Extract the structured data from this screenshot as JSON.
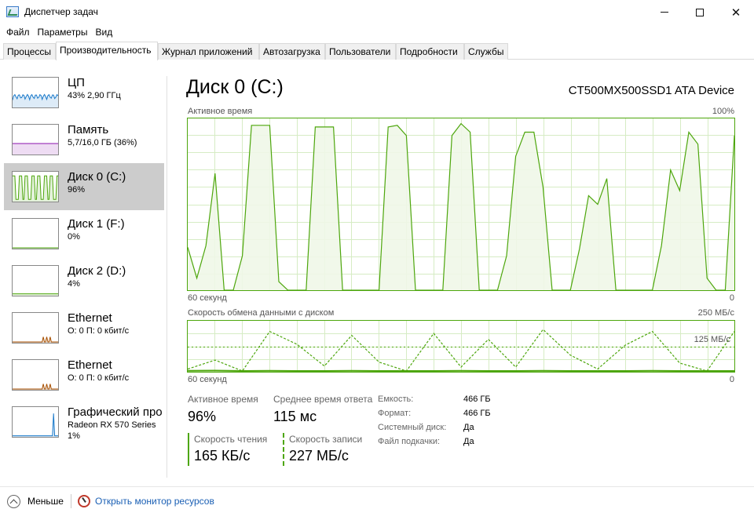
{
  "window": {
    "title": "Диспетчер задач",
    "app_icon": "task-manager-icon",
    "controls": {
      "minimize": "—",
      "close": "✕"
    }
  },
  "menu": [
    "Файл",
    "Параметры",
    "Вид"
  ],
  "tabs": [
    "Процессы",
    "Производительность",
    "Журнал приложений",
    "Автозагрузка",
    "Пользователи",
    "Подробности",
    "Службы"
  ],
  "active_tab": "Производительность",
  "sidebar": {
    "items": [
      {
        "name": "ЦП",
        "sub": "43% 2,90 ГГц",
        "color": "#1979ca",
        "level_pct": 43
      },
      {
        "name": "Память",
        "sub": "5,7/16,0 ГБ (36%)",
        "color": "#8b12ae",
        "level_pct": 36
      },
      {
        "name": "Диск 0 (C:)",
        "sub": "96%",
        "color": "#4da60c",
        "level_pct": 96,
        "selected": true
      },
      {
        "name": "Диск 1 (F:)",
        "sub": "0%",
        "color": "#4da60c",
        "level_pct": 0
      },
      {
        "name": "Диск 2 (D:)",
        "sub": "4%",
        "color": "#4da60c",
        "level_pct": 4
      },
      {
        "name": "Ethernet",
        "sub": "О: 0 П: 0 кбит/с",
        "color": "#a74f01"
      },
      {
        "name": "Ethernet",
        "sub": "О: 0 П: 0 кбит/с",
        "color": "#a74f01"
      },
      {
        "name": "Графический про",
        "sub": "Radeon RX 570 Series",
        "sub2": "1%",
        "color": "#1979ca",
        "level_pct": 1
      }
    ]
  },
  "main": {
    "title": "Диск 0 (C:)",
    "device": "CT500MX500SSD1 ATA Device",
    "chart1": {
      "label": "Активное время",
      "max_label": "100%",
      "x_label": "60 секунд",
      "min_label": "0"
    },
    "chart2": {
      "label": "Скорость обмена данными с диском",
      "max_label": "250 МБ/с",
      "mid_label": "125 МБ/с",
      "x_label": "60 секунд",
      "min_label": "0"
    },
    "stats": {
      "active_time_label": "Активное время",
      "active_time_value": "96%",
      "response_label": "Среднее время ответа",
      "response_value": "115 мс",
      "read_label": "Скорость чтения",
      "read_value": "165 КБ/с",
      "write_label": "Скорость записи",
      "write_value": "227 МБ/с"
    },
    "properties": [
      {
        "label": "Емкость:",
        "value": "466 ГБ"
      },
      {
        "label": "Формат:",
        "value": "466 ГБ"
      },
      {
        "label": "Системный диск:",
        "value": "Да"
      },
      {
        "label": "Файл подкачки:",
        "value": "Да"
      }
    ]
  },
  "footer": {
    "less_label": "Меньше",
    "less_icon": "chevron-up-circle-icon",
    "resmon_label": "Открыть монитор ресурсов",
    "resmon_icon": "resource-monitor-icon"
  },
  "colors": {
    "disk_line": "#4da60c",
    "disk_fill": "#eff7e8",
    "grid": "#d6ecc4",
    "selected_bg": "#cccccc"
  },
  "chart_data": [
    {
      "type": "area",
      "title": "Активное время",
      "xlabel": "60 секунд",
      "ylabel": "",
      "ylim": [
        0,
        100
      ],
      "x": [
        60,
        59,
        58,
        57,
        56,
        55,
        54,
        53,
        52,
        51,
        50,
        49,
        48,
        47,
        46,
        45,
        44,
        43,
        42,
        41,
        40,
        39,
        38,
        37,
        36,
        35,
        34,
        33,
        32,
        31,
        30,
        29,
        28,
        27,
        26,
        25,
        24,
        23,
        22,
        21,
        20,
        19,
        18,
        17,
        16,
        15,
        14,
        13,
        12,
        11,
        10,
        9,
        8,
        7,
        6,
        5,
        4,
        3,
        2,
        1,
        0
      ],
      "series": [
        {
          "values": [
            25,
            7,
            26,
            68,
            0,
            0,
            20,
            96,
            96,
            96,
            5,
            0,
            0,
            0,
            95,
            95,
            95,
            0,
            0,
            0,
            0,
            0,
            95,
            96,
            90,
            0,
            0,
            0,
            0,
            90,
            97,
            92,
            0,
            0,
            0,
            20,
            78,
            92,
            92,
            60,
            0,
            0,
            0,
            24,
            55,
            50,
            65,
            0,
            0,
            0,
            0,
            0,
            26,
            70,
            58,
            92,
            85,
            7,
            0,
            0,
            90
          ]
        }
      ]
    },
    {
      "type": "line",
      "title": "Скорость обмена данными с диском",
      "xlabel": "60 секунд",
      "ylabel": "МБ/с",
      "ylim": [
        0,
        250
      ],
      "x": [
        60,
        57,
        54,
        51,
        48,
        45,
        42,
        39,
        36,
        33,
        30,
        27,
        24,
        21,
        18,
        15,
        12,
        9,
        6,
        3,
        0
      ],
      "series": [
        {
          "name": "Скорость записи",
          "values": [
            10,
            55,
            0,
            200,
            135,
            25,
            180,
            45,
            0,
            190,
            20,
            160,
            20,
            210,
            80,
            10,
            130,
            200,
            40,
            0,
            200
          ]
        },
        {
          "name": "Скорость чтения",
          "values": [
            1,
            2,
            0,
            1,
            0,
            0,
            1,
            0,
            0,
            0,
            1,
            0,
            0,
            1,
            0,
            0,
            0,
            1,
            0,
            0,
            0
          ]
        }
      ]
    }
  ]
}
